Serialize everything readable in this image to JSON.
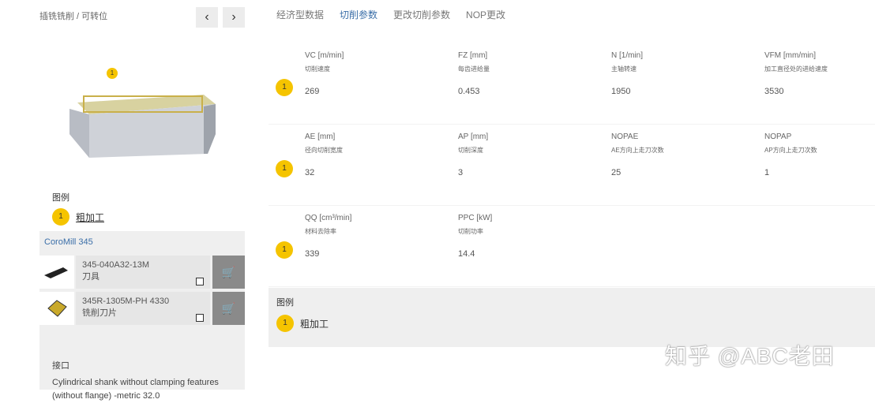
{
  "breadcrumb": "插铣铣削 / 可转位",
  "nav": {
    "prev": "‹",
    "next": "›"
  },
  "tabs": [
    {
      "label": "经济型数据"
    },
    {
      "label": "切削参数"
    },
    {
      "label": "更改切削参数"
    },
    {
      "label": "NOP更改"
    }
  ],
  "diagram_badge": "1",
  "legend": {
    "title": "图例",
    "items": [
      {
        "num": "1",
        "label": "粗加工"
      }
    ]
  },
  "product": {
    "title": "CoroMill 345",
    "items": [
      {
        "code": "345-040A32-13M",
        "type": "刀具"
      },
      {
        "code": "345R-1305M-PH 4330",
        "type": "铣削刀片"
      }
    ],
    "interface_title": "接口",
    "interface_text": "Cylindrical shank without clamping features (without flange) -metric 32.0"
  },
  "parameters": [
    {
      "num": "1",
      "cells": [
        {
          "code": "VC [m/min]",
          "desc": "切削速度",
          "value": "269"
        },
        {
          "code": "FZ [mm]",
          "desc": "每齿进给量",
          "value": "0.453"
        },
        {
          "code": "N [1/min]",
          "desc": "主轴转速",
          "value": "1950"
        },
        {
          "code": "VFM [mm/min]",
          "desc": "加工直径处的进给速度",
          "value": "3530"
        }
      ]
    },
    {
      "num": "1",
      "cells": [
        {
          "code": "AE [mm]",
          "desc": "径向切削宽度",
          "value": "32"
        },
        {
          "code": "AP [mm]",
          "desc": "切削深度",
          "value": "3"
        },
        {
          "code": "NOPAE",
          "desc": "AE方向上走刀次数",
          "value": "25"
        },
        {
          "code": "NOPAP",
          "desc": "AP方向上走刀次数",
          "value": "1"
        }
      ]
    },
    {
      "num": "1",
      "cells": [
        {
          "code": "QQ [cm³/min]",
          "desc": "材料去除率",
          "value": "339"
        },
        {
          "code": "PPC [kW]",
          "desc": "切削功率",
          "value": "14.4"
        }
      ]
    }
  ],
  "bottom_legend": {
    "title": "图例",
    "num": "1",
    "label": "粗加工"
  },
  "watermark": "知乎 @ABC老田"
}
